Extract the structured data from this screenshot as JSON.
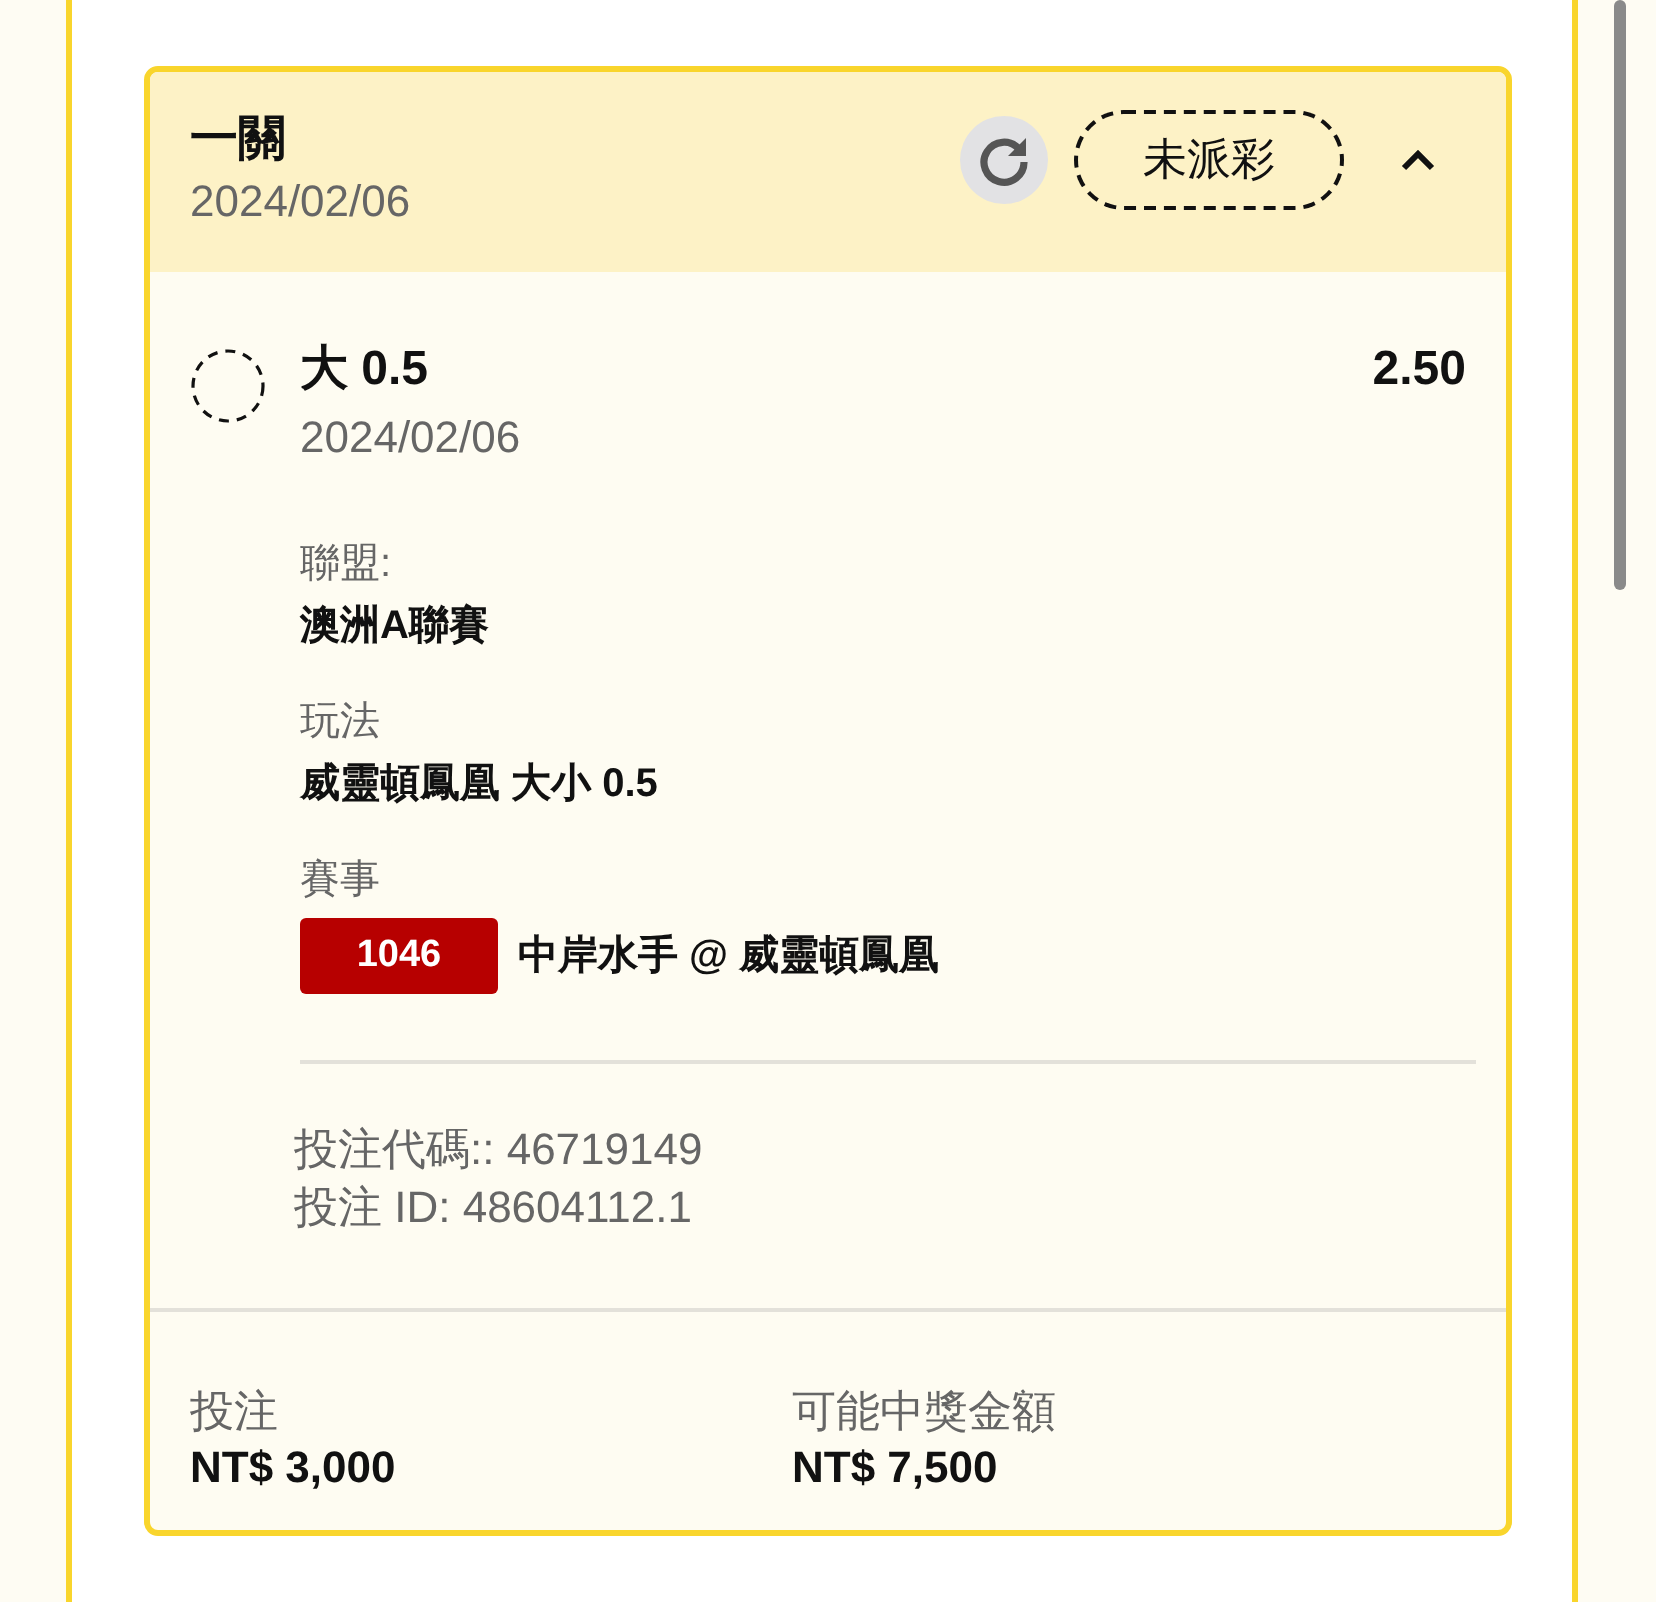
{
  "bet": {
    "title": "一關",
    "date": "2024/02/06",
    "status": "未派彩",
    "expanded": true,
    "selection": {
      "name": "大 0.5",
      "odds": "2.50",
      "date": "2024/02/06",
      "fields": [
        {
          "kind": "text",
          "label": "聯盟:",
          "value": "澳洲A聯賽"
        },
        {
          "kind": "text",
          "label": "玩法",
          "value": "威靈頓鳳凰 大小 0.5"
        },
        {
          "kind": "match",
          "label": "賽事",
          "code": "1046",
          "value": "中岸水手 @ 威靈頓鳳凰"
        }
      ]
    },
    "codes": [
      "投注代碼:: 46719149",
      "投注 ID: 48604112.1"
    ],
    "totals": [
      {
        "label": "投注",
        "value": "NT$ 3,000"
      },
      {
        "label": "可能中獎金額",
        "value": "NT$ 7,500"
      }
    ]
  }
}
